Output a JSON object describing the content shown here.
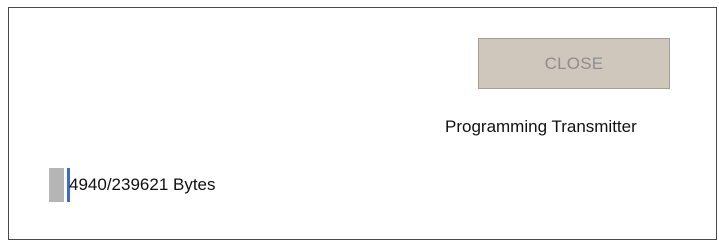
{
  "dialog": {
    "close_button_label": "CLOSE",
    "status_text": "Programming Transmitter",
    "progress": {
      "bytes_text": "4940/239621 Bytes",
      "fraction": 0.0206
    }
  },
  "colors": {
    "button_bg": "#cfc6bc",
    "button_text_disabled": "#8e8e8e",
    "progress_fill": "#b5b5b5",
    "progress_accent": "#3b6cc7",
    "window_border": "#4a4a4a"
  }
}
